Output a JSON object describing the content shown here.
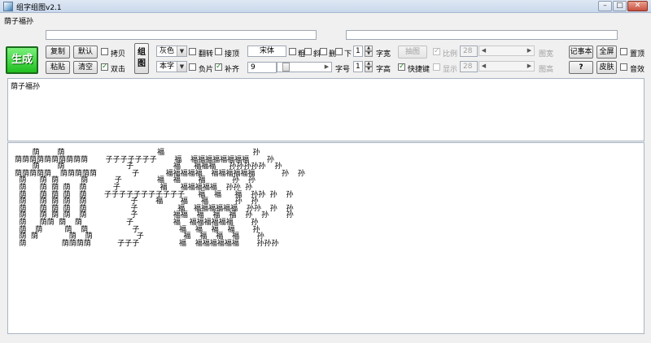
{
  "window": {
    "title": "组字组图v2.1",
    "min_icon": "minimize-icon",
    "max_icon": "maximize-icon",
    "close_icon": "close-icon",
    "min_symbol": "–",
    "max_symbol": "□",
    "close_symbol": "✕"
  },
  "input_text": "荫子福孙",
  "fields": {
    "text_left": "",
    "text_right": ""
  },
  "buttons": {
    "generate": "生成",
    "copy": "复制",
    "default": "默认",
    "paste": "粘贴",
    "clear": "清空",
    "compose_image": "组\n图",
    "extract_image": "抽图",
    "notepad": "记事本",
    "fullscreen": "全屏",
    "help": "?",
    "skin": "皮肤"
  },
  "checkboxes": {
    "copy_check": {
      "label": "拷贝",
      "checked": false
    },
    "double_click": {
      "label": "双击",
      "checked": true
    },
    "flip": {
      "label": "翻转",
      "checked": false
    },
    "top_align": {
      "label": "接顶",
      "checked": false
    },
    "negative": {
      "label": "负片",
      "checked": false
    },
    "fill": {
      "label": "补齐",
      "checked": true
    },
    "bold": {
      "label": "粗",
      "checked": false
    },
    "italic": {
      "label": "斜",
      "checked": false
    },
    "strike": {
      "label": "删",
      "checked": false
    },
    "underline": {
      "label": "下",
      "checked": false
    },
    "shortcut": {
      "label": "快捷键",
      "checked": true
    },
    "ratio": {
      "label": "比例",
      "checked": true
    },
    "display": {
      "label": "显示",
      "checked": false
    },
    "on_top": {
      "label": "置顶",
      "checked": false
    },
    "sound": {
      "label": "音效",
      "checked": false
    }
  },
  "selects": {
    "color": "灰色",
    "char_source": "本字",
    "font_name": "宋体",
    "font_size": "9"
  },
  "spinners": {
    "char_width": "1",
    "char_height": "1"
  },
  "labels": {
    "font_size": "字号",
    "char_width": "字宽",
    "char_height": "字高",
    "image_width": "图宽",
    "image_height": "图高"
  },
  "sliders": {
    "ratio_value": "28",
    "display_value": "28"
  },
  "preview_text": "荫子福孙",
  "ascii_art": [
    "    荫    荫                     福                    孙",
    "荫荫荫荫荫荫荫荫荫荫    子子子子子子子    福  福福福福福福福福    孙",
    "    荫    荫              子         福   福福福   孙孙孙孙孙  孙",
    "荫荫荫荫荫  荫荫荫荫荫        子      福福福福福  福福福福福福      孙  孙",
    " 荫   荫 荫     荫      子        福  福    福      孙  孙",
    " 荫   荫 荫 荫  荫      子         福   福福福福福  孙孙 孙",
    " 荫   荫 荫 荫  荫    子子子子子子子子子子子   福  福   福  孙孙 孙  孙",
    " 荫   荫 荫 荫  荫          子    福    福   福      孙  孙",
    " 荫   荫 荫 荫  荫          子         福  福福福福福福  孙孙  孙  孙",
    " 荫   荫 荫 荫  荫          子        福福  福  福  福  孙  孙    孙",
    " 荫   荫荫 荫  荫          子         福  福福福福福福    孙",
    " 荫  荫     荫  荫          子         福  福  福  福    孙",
    " 荫 荫       荫  荫          子         福  福  福  福    孙",
    " 荫        荫荫荫荫      子子子         福  福福福福福福    孙孙孙"
  ]
}
